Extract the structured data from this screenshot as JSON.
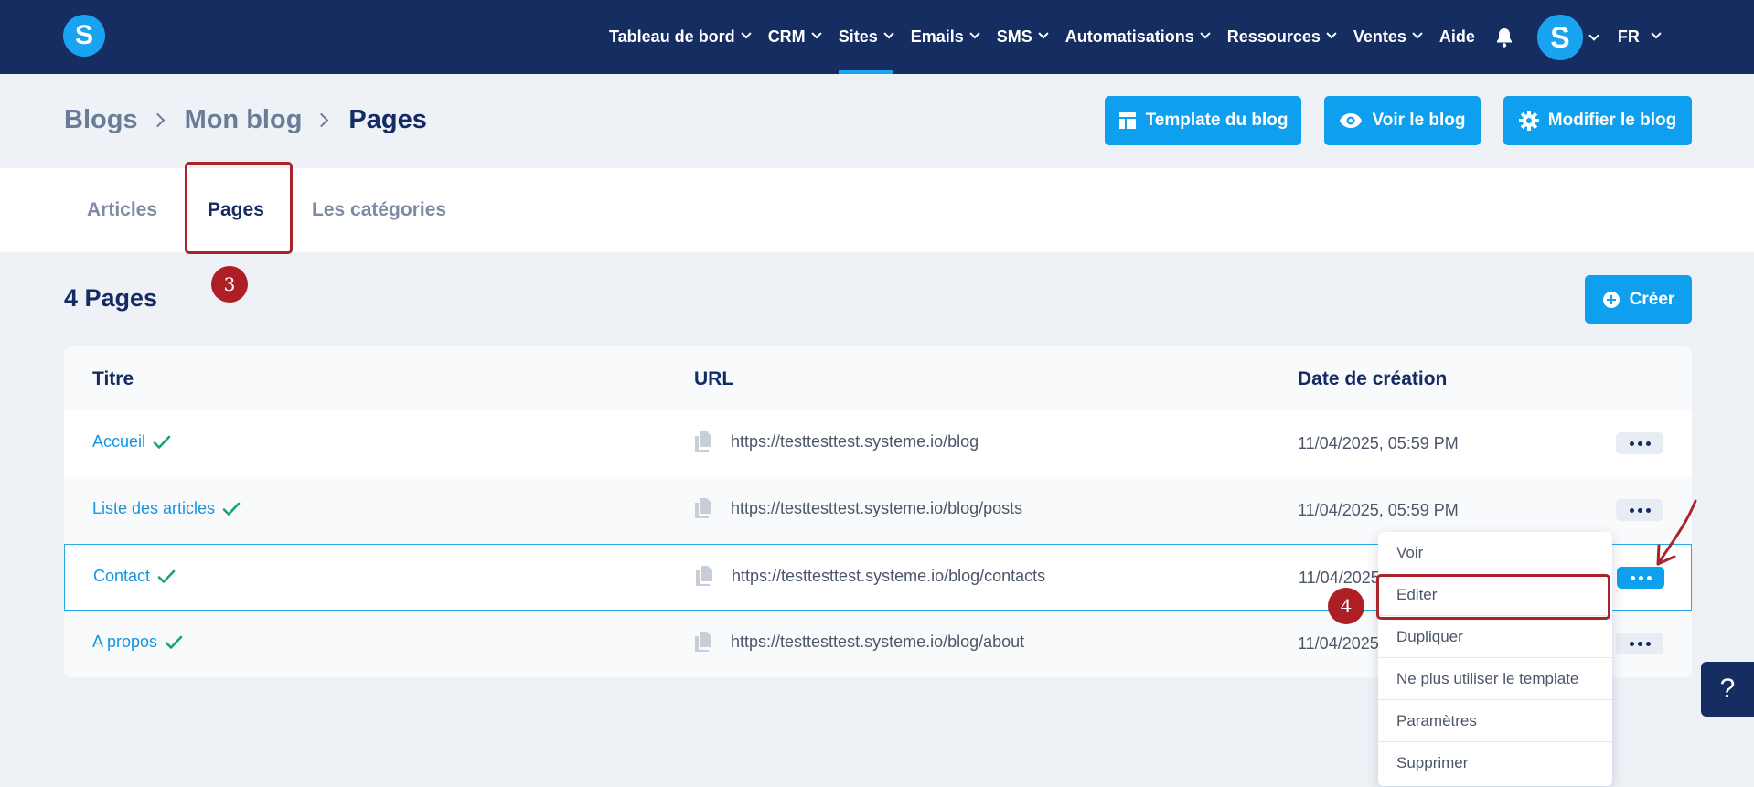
{
  "nav": {
    "logo": "S",
    "items": [
      {
        "label": "Tableau de bord",
        "chevron": true
      },
      {
        "label": "CRM",
        "chevron": true
      },
      {
        "label": "Sites",
        "chevron": true
      },
      {
        "label": "Emails",
        "chevron": true
      },
      {
        "label": "SMS",
        "chevron": true
      },
      {
        "label": "Automatisations",
        "chevron": true
      },
      {
        "label": "Ressources",
        "chevron": true
      },
      {
        "label": "Ventes",
        "chevron": true
      },
      {
        "label": "Aide",
        "chevron": false
      }
    ],
    "active_item": "Sites",
    "avatar_letter": "S",
    "language": "FR"
  },
  "breadcrumb": [
    "Blogs",
    "Mon blog",
    "Pages"
  ],
  "header_buttons": {
    "template": "Template du blog",
    "view": "Voir le blog",
    "edit": "Modifier le blog"
  },
  "tabs": [
    "Articles",
    "Pages",
    "Les catégories"
  ],
  "active_tab": "Pages",
  "annotations": {
    "step3": "3",
    "step4": "4"
  },
  "page_count_label": "4 Pages",
  "create_label": "Créer",
  "table": {
    "headers": [
      "Titre",
      "URL",
      "Date de création"
    ],
    "rows": [
      {
        "title": "Accueil",
        "url": "https://testtesttest.systeme.io/blog",
        "date": "11/04/2025, 05:59 PM"
      },
      {
        "title": "Liste des articles",
        "url": "https://testtesttest.systeme.io/blog/posts",
        "date": "11/04/2025, 05:59 PM"
      },
      {
        "title": "Contact",
        "url": "https://testtesttest.systeme.io/blog/contacts",
        "date": "11/04/2025"
      },
      {
        "title": "A propos",
        "url": "https://testtesttest.systeme.io/blog/about",
        "date": "11/04/2025"
      }
    ]
  },
  "dropdown": [
    "Voir",
    "Editer",
    "Dupliquer",
    "Ne plus utiliser le template",
    "Paramètres",
    "Supprimer"
  ],
  "help_label": "?",
  "colors": {
    "nav_bg": "#152d61",
    "accent": "#0ea0ef",
    "annotation_red": "#ad1f24",
    "link": "#1594e0",
    "check": "#17a673"
  }
}
